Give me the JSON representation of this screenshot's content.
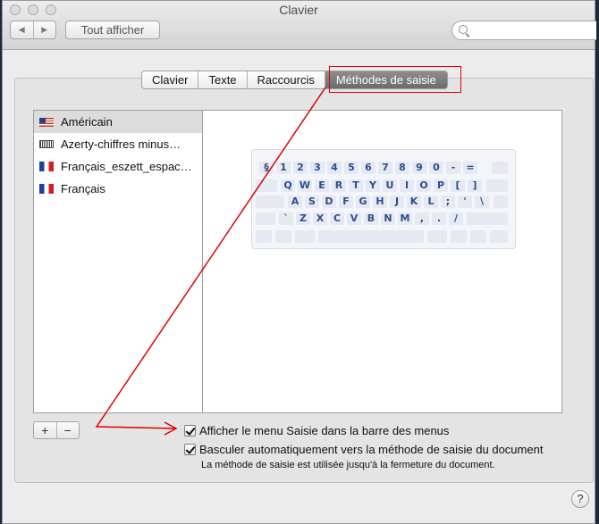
{
  "window": {
    "title": "Clavier"
  },
  "toolbar": {
    "back_glyph": "◀",
    "forward_glyph": "▶",
    "show_all_label": "Tout afficher",
    "search_placeholder": ""
  },
  "tabs": [
    {
      "label": "Clavier",
      "active": false
    },
    {
      "label": "Texte",
      "active": false
    },
    {
      "label": "Raccourcis",
      "active": false
    },
    {
      "label": "Méthodes de saisie",
      "active": true
    }
  ],
  "input_sources": [
    {
      "label": "Américain",
      "icon": "us-flag-icon",
      "selected": true
    },
    {
      "label": "Azerty-chiffres minus…",
      "icon": "keyboard-icon",
      "selected": false
    },
    {
      "label": "Français_eszett_espac…",
      "icon": "french-flag-icon",
      "selected": false
    },
    {
      "label": "Français",
      "icon": "french-flag-icon",
      "selected": false
    }
  ],
  "keyboard_rows": [
    [
      "§",
      "1",
      "2",
      "3",
      "4",
      "5",
      "6",
      "7",
      "8",
      "9",
      "0",
      "-",
      "="
    ],
    [
      "Q",
      "W",
      "E",
      "R",
      "T",
      "Y",
      "U",
      "I",
      "O",
      "P",
      "[",
      "]"
    ],
    [
      "A",
      "S",
      "D",
      "F",
      "G",
      "H",
      "J",
      "K",
      "L",
      ";",
      "'",
      "\\"
    ],
    [
      "`",
      "Z",
      "X",
      "C",
      "V",
      "B",
      "N",
      "M",
      ",",
      ".",
      "/"
    ]
  ],
  "list_buttons": {
    "add": "+",
    "remove": "−"
  },
  "options": {
    "show_menu_label": "Afficher le menu Saisie dans la barre des menus",
    "show_menu_checked": true,
    "auto_switch_label": "Basculer automatiquement vers la méthode de saisie du document",
    "auto_switch_checked": true,
    "note": "La méthode de saisie est utilisée jusqu'à la fermeture du document."
  },
  "help": {
    "label": "?"
  },
  "colors": {
    "annotation": "#e00000",
    "key_text": "#2f4d8f",
    "active_tab": "#7a7a7a"
  }
}
